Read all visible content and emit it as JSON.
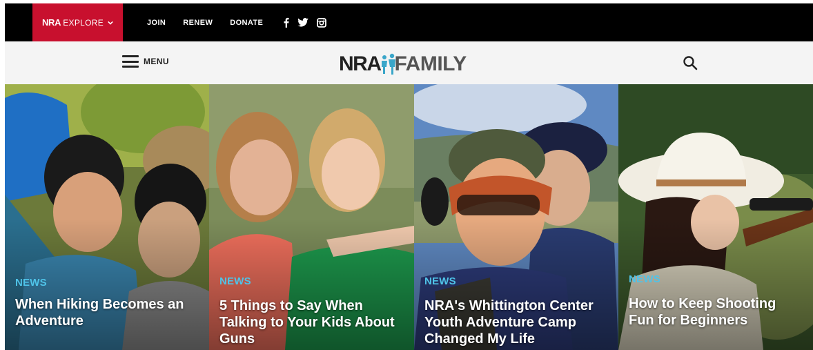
{
  "topbar": {
    "explore": {
      "brand": "NRA",
      "label": "EXPLORE"
    },
    "links": [
      {
        "label": "JOIN"
      },
      {
        "label": "RENEW"
      },
      {
        "label": "DONATE"
      }
    ],
    "social": [
      "facebook-icon",
      "twitter-icon",
      "instagram-icon"
    ]
  },
  "header": {
    "menu_label": "MENU",
    "logo": {
      "left": "NRA",
      "right": "FAMILY"
    },
    "search_icon": "search-icon"
  },
  "colors": {
    "topbar_bg": "#000000",
    "explore_bg": "#c8102e",
    "header_bg": "#f4f4f4",
    "tag": "#4fc3e8",
    "title": "#ffffff"
  },
  "cards": [
    {
      "tag": "NEWS",
      "title": "When Hiking Becomes an Adventure"
    },
    {
      "tag": "NEWS",
      "title": "5 Things to Say When Talking to Your Kids About Guns"
    },
    {
      "tag": "NEWS",
      "title": "NRA's Whittington Center Youth Adventure Camp Changed My Life"
    },
    {
      "tag": "NEWS",
      "title": "How to Keep Shooting Fun for Beginners"
    }
  ]
}
